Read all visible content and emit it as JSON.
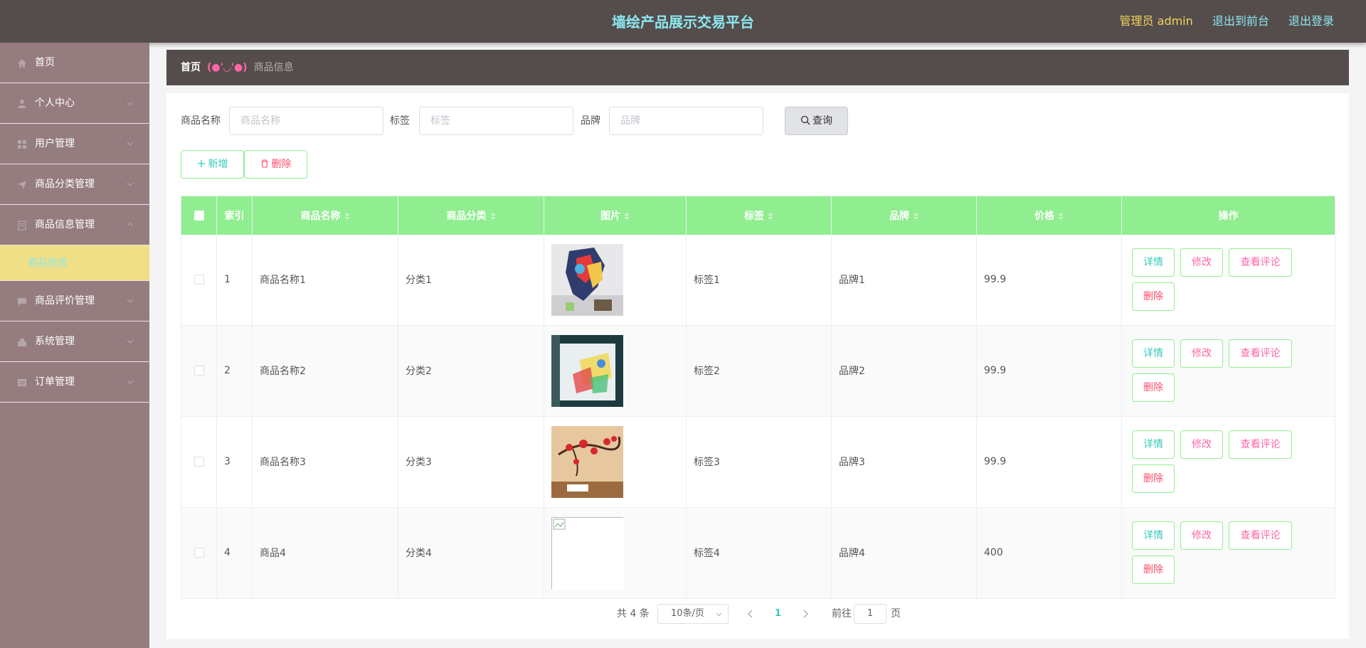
{
  "header": {
    "title": "墙绘产品展示交易平台",
    "admin": "管理员 admin",
    "to_front": "退出到前台",
    "logout": "退出登录"
  },
  "sidebar": {
    "items": [
      {
        "label": "首页",
        "icon": "home-icon"
      },
      {
        "label": "个人中心",
        "icon": "user-icon"
      },
      {
        "label": "用户管理",
        "icon": "grid-icon"
      },
      {
        "label": "商品分类管理",
        "icon": "send-icon"
      },
      {
        "label": "商品信息管理",
        "icon": "document-icon"
      },
      {
        "label": "商品评价管理",
        "icon": "chat-icon"
      },
      {
        "label": "系统管理",
        "icon": "settings-icon"
      },
      {
        "label": "订单管理",
        "icon": "list-icon"
      }
    ],
    "active_sub": "商品信息"
  },
  "breadcrumb": {
    "home": "首页",
    "separator": "(●'◡'●)",
    "current": "商品信息"
  },
  "search": {
    "name_label": "商品名称",
    "name_placeholder": "商品名称",
    "tag_label": "标签",
    "tag_placeholder": "标签",
    "brand_label": "品牌",
    "brand_placeholder": "品牌",
    "query_button": "查询"
  },
  "actions": {
    "add": "新增",
    "delete": "删除"
  },
  "table": {
    "headers": {
      "index": "索引",
      "name": "商品名称",
      "category": "商品分类",
      "image": "图片",
      "tag": "标签",
      "brand": "品牌",
      "price": "价格",
      "ops": "操作"
    },
    "rows": [
      {
        "index": "1",
        "name": "商品名称1",
        "category": "分类1",
        "tag": "标签1",
        "brand": "品牌1",
        "price": "99.9"
      },
      {
        "index": "2",
        "name": "商品名称2",
        "category": "分类2",
        "tag": "标签2",
        "brand": "品牌2",
        "price": "99.9"
      },
      {
        "index": "3",
        "name": "商品名称3",
        "category": "分类3",
        "tag": "标签3",
        "brand": "品牌3",
        "price": "99.9"
      },
      {
        "index": "4",
        "name": "商品4",
        "category": "分类4",
        "tag": "标签4",
        "brand": "品牌4",
        "price": "400"
      }
    ],
    "row_buttons": {
      "detail": "详情",
      "edit": "修改",
      "review": "查看评论",
      "remove": "删除"
    }
  },
  "pagination": {
    "total": "共 4 条",
    "page_size": "10条/页",
    "current_page": "1",
    "goto_label": "前往",
    "goto_value": "1",
    "goto_unit": "页"
  },
  "colors": {
    "header_bg": "#544d4c",
    "sidebar_bg": "#957c7e",
    "active_sub_bg": "#efdf86",
    "table_header_bg": "#90ee90",
    "accent_teal": "#35c9b7",
    "accent_pink": "#ff66a6",
    "accent_red": "#ff4d6a",
    "title_color": "#8de8f1",
    "admin_color": "#f4d35e"
  }
}
